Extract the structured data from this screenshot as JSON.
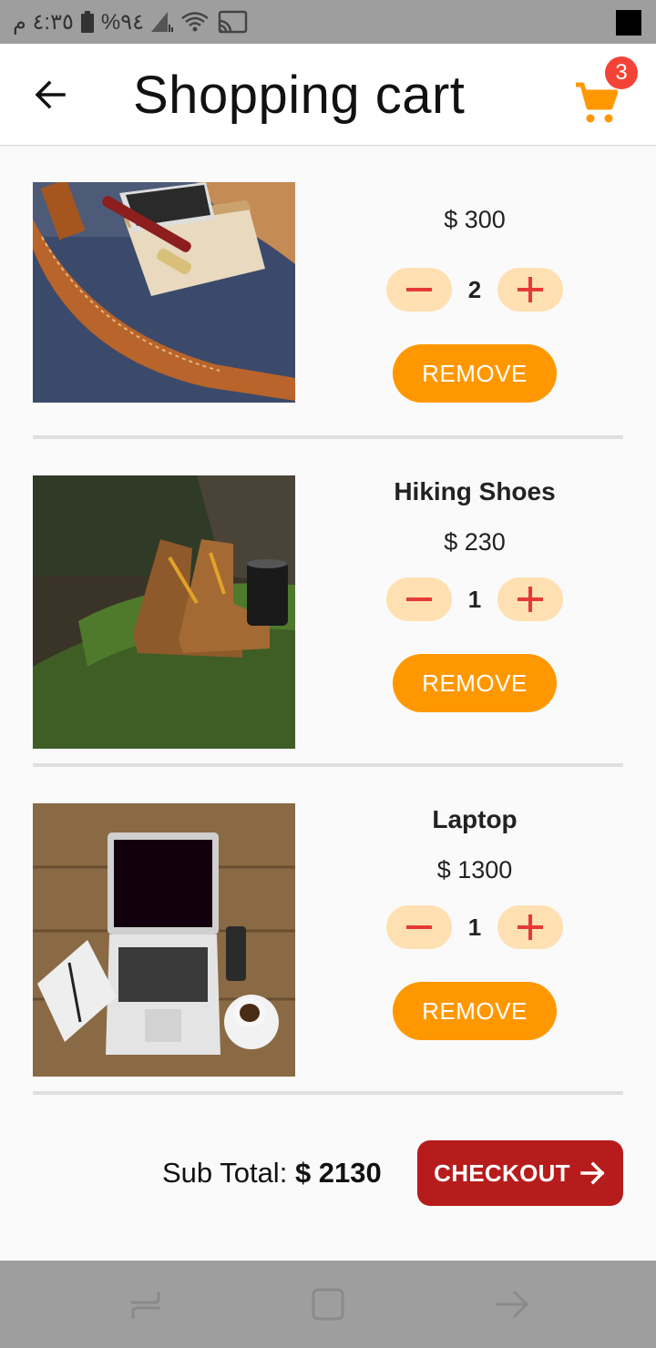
{
  "status_bar": {
    "time": "٤:٣٥ م",
    "battery": "%٩٤"
  },
  "header": {
    "title": "Shopping cart",
    "cart_count": "3"
  },
  "items": [
    {
      "name": "",
      "price": "$ 300",
      "quantity": "2",
      "remove_label": "REMOVE"
    },
    {
      "name": "Hiking Shoes",
      "price": "$ 230",
      "quantity": "1",
      "remove_label": "REMOVE"
    },
    {
      "name": "Laptop",
      "price": "$ 1300",
      "quantity": "1",
      "remove_label": "REMOVE"
    }
  ],
  "footer": {
    "subtotal_label": "Sub Total:",
    "subtotal_value": "$ 2130",
    "checkout_label": "CHECKOUT"
  },
  "colors": {
    "accent": "#ff9800",
    "qty_bg": "#ffe0b2",
    "qty_icon": "#e53935",
    "checkout": "#b71c1c",
    "badge": "#f44336"
  },
  "icons": {
    "back": "arrow-left",
    "cart": "shopping-cart",
    "minus": "minus",
    "plus": "plus",
    "checkout": "arrow-right"
  }
}
